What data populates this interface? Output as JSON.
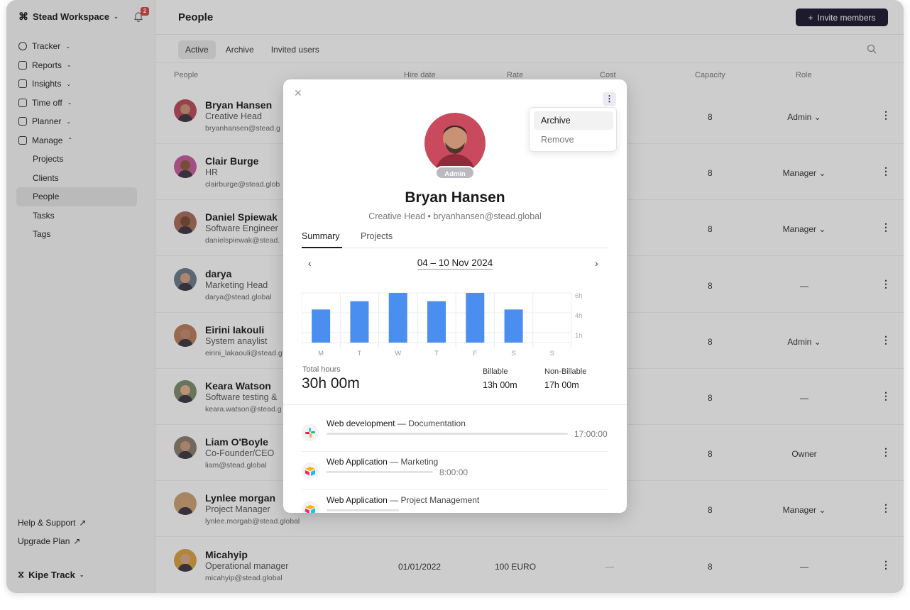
{
  "workspace": {
    "name": "Stead Workspace",
    "notification_count": "2"
  },
  "sidebar": {
    "items": [
      {
        "label": "Tracker",
        "icon": "tracker-icon"
      },
      {
        "label": "Reports",
        "icon": "reports-icon"
      },
      {
        "label": "Insights",
        "icon": "insights-icon"
      },
      {
        "label": "Time off",
        "icon": "timeoff-icon"
      },
      {
        "label": "Planner",
        "icon": "planner-icon"
      },
      {
        "label": "Manage",
        "icon": "manage-icon"
      }
    ],
    "manage_items": [
      {
        "label": "Projects"
      },
      {
        "label": "Clients"
      },
      {
        "label": "People",
        "active": true
      },
      {
        "label": "Tasks"
      },
      {
        "label": "Tags"
      }
    ],
    "help": "Help & Support",
    "upgrade": "Upgrade Plan",
    "brand": "Kipe Track"
  },
  "header": {
    "title": "People",
    "invite_label": "Invite members"
  },
  "tabs": [
    {
      "label": "Active",
      "active": true
    },
    {
      "label": "Archive"
    },
    {
      "label": "Invited users"
    }
  ],
  "table": {
    "columns": {
      "people": "People",
      "hire_date": "Hire date",
      "rate": "Rate",
      "cost": "Cost",
      "capacity": "Capacity",
      "role": "Role"
    },
    "rows": [
      {
        "name": "Bryan Hansen",
        "title": "Creative Head",
        "email": "bryanhansen@stead.g",
        "capacity": "8",
        "role": "Admin ⌄"
      },
      {
        "name": "Clair Burge",
        "title": "HR",
        "email": "clairburge@stead.glob",
        "capacity": "8",
        "role": "Manager ⌄"
      },
      {
        "name": "Daniel Spiewak",
        "title": "Software Engineer",
        "email": "danielspiewak@stead.",
        "capacity": "8",
        "role": "Manager ⌄"
      },
      {
        "name": "darya",
        "title": "Marketing Head",
        "email": "darya@stead.global",
        "capacity": "8",
        "role": "—"
      },
      {
        "name": "Eirini Iakouli",
        "title": "System anaylist",
        "email": "eirini_lakaouli@stead.g",
        "capacity": "8",
        "role": "Admin ⌄"
      },
      {
        "name": "Keara Watson",
        "title": "Software testing &",
        "email": "keara.watson@stead.g",
        "capacity": "8",
        "role": "—"
      },
      {
        "name": "Liam O'Boyle",
        "title": "Co-Founder/CEO",
        "email": "liam@stead.global",
        "capacity": "8",
        "role": "Owner"
      },
      {
        "name": "Lynlee morgan",
        "title": "Project Manager",
        "email": "lynlee.morgab@stead.global",
        "capacity": "8",
        "role": "Manager ⌄"
      },
      {
        "name": "Micahyip",
        "title": "Operational manager",
        "email": "micahyip@stead.global",
        "hire_date": "01/01/2022",
        "rate": "100 EURO",
        "cost": "—",
        "capacity": "8",
        "role": "—"
      }
    ]
  },
  "modal": {
    "badge": "Admin",
    "name": "Bryan Hansen",
    "subtitle": "Creative Head  •  bryanhansen@stead.global",
    "tabs": [
      {
        "label": "Summary",
        "active": true
      },
      {
        "label": "Projects"
      }
    ],
    "week": "04 – 10 Nov 2024",
    "total_label": "Total hours",
    "total_value": "30h 00m",
    "billable_label": "Billable",
    "billable_value": "13h 00m",
    "nonbillable_label": "Non-Billable",
    "nonbillable_value": "17h 00m",
    "projects": [
      {
        "name": "Web development",
        "task": "— Documentation",
        "time": "17:00:00",
        "icon": "slack-icon",
        "progress": 1.0
      },
      {
        "name": "Web Application",
        "task": "— Marketing",
        "time": "8:00:00",
        "icon": "airtable-icon",
        "progress": 0.44
      },
      {
        "name": "Web Application",
        "task": "— Project Management",
        "time": "",
        "icon": "airtable-icon",
        "progress": 0.3
      }
    ],
    "menu": [
      {
        "label": "Archive"
      },
      {
        "label": "Remove"
      }
    ]
  },
  "chart_data": {
    "type": "bar",
    "categories": [
      "M",
      "T",
      "W",
      "T",
      "F",
      "S",
      "S"
    ],
    "values": [
      4,
      5,
      6,
      5,
      6,
      4,
      0
    ],
    "ylim": [
      0,
      6
    ],
    "yticks": [
      "1h",
      "4h",
      "6h"
    ],
    "color": "#4a8ef0"
  },
  "colors": {
    "accent": "#1a1730",
    "bar": "#4a8ef0",
    "notification": "#d94040"
  }
}
